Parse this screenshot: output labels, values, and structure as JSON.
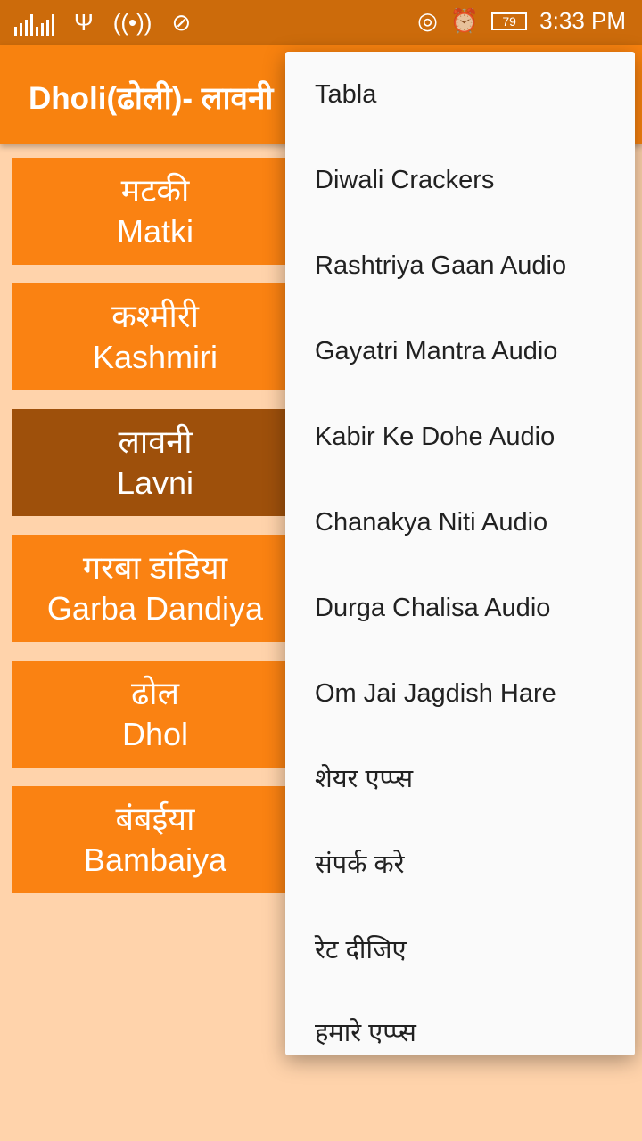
{
  "status_bar": {
    "time": "3:33 PM",
    "battery": "79",
    "icons": [
      "signal-icon",
      "usb-icon",
      "hotspot-icon",
      "no-sound-icon",
      "wifi-icon",
      "alarm-icon",
      "battery-icon"
    ]
  },
  "app_bar": {
    "title": "Dholi(ढोली)- लावनी"
  },
  "buttons": [
    {
      "hi": "मटकी",
      "en": "Matki"
    },
    {
      "hi": "कश्मीरी",
      "en": "Kashmiri"
    },
    {
      "hi": "लावनी",
      "en": "Lavni",
      "selected": true
    },
    {
      "hi": "गरबा डांडिया",
      "en": "Garba Dandiya"
    },
    {
      "hi": "ढोल",
      "en": "Dhol"
    },
    {
      "hi": "बंबईया",
      "en": "Bambaiya"
    }
  ],
  "menu": [
    "Tabla",
    "Diwali Crackers",
    "Rashtriya Gaan Audio",
    "Gayatri Mantra Audio",
    "Kabir Ke Dohe Audio",
    "Chanakya Niti Audio",
    "Durga Chalisa Audio",
    "Om Jai Jagdish Hare",
    "शेयर एप्प्स",
    "संपर्क करे",
    "रेट दीजिए",
    "हमारे एप्प्स"
  ],
  "colors": {
    "status": "#cc6b0b",
    "appbar": "#f8820f",
    "button": "#fa8212",
    "selected": "#9e500b",
    "background": "#ffd3ab"
  }
}
